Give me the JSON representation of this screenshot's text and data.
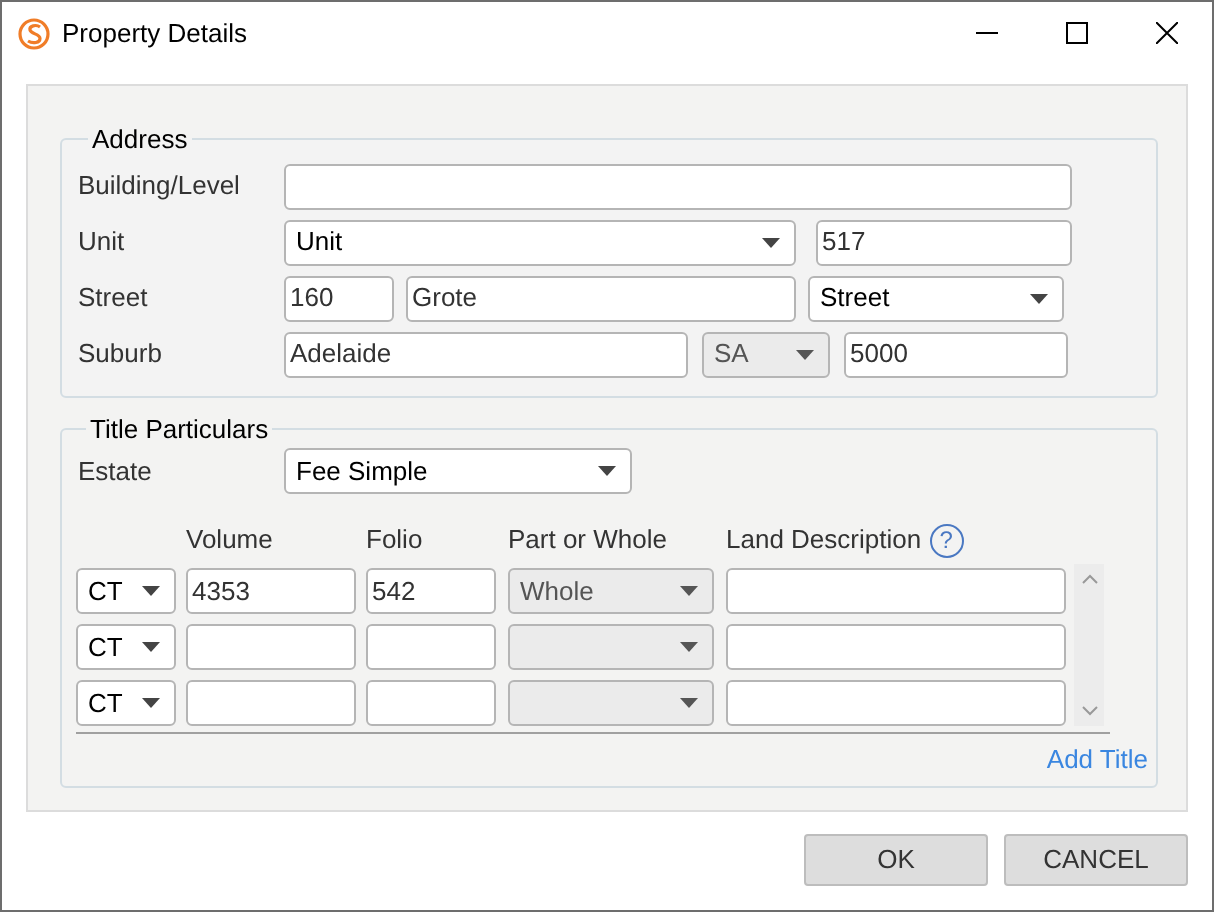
{
  "window": {
    "title": "Property Details"
  },
  "address": {
    "legend": "Address",
    "rows": [
      {
        "label": "Building/Level",
        "fields": [
          {
            "kind": "input"
          }
        ]
      },
      {
        "label": "Unit",
        "fields": [
          {
            "kind": "select",
            "value": "Unit",
            "disabled": false
          },
          {
            "kind": "input",
            "value": "517"
          }
        ]
      },
      {
        "label": "Street",
        "fields": [
          {
            "kind": "input",
            "value": "160"
          },
          {
            "kind": "input",
            "value": "Grote"
          },
          {
            "kind": "select",
            "value": "Street",
            "disabled": false
          }
        ]
      },
      {
        "label": "Suburb",
        "fields": [
          {
            "kind": "input",
            "value": "Adelaide"
          },
          {
            "kind": "select",
            "value": "SA",
            "disabled": true
          },
          {
            "kind": "input",
            "value": "5000"
          }
        ]
      }
    ]
  },
  "title_particulars": {
    "legend": "Title Particulars",
    "estate": {
      "label": "Estate",
      "value": "Fee Simple"
    },
    "columns": [
      "Volume",
      "Folio",
      "Part or Whole",
      "Land Description"
    ],
    "help": "?",
    "rows": [
      {
        "type": "CT",
        "volume": "4353",
        "folio": "542",
        "part": "Whole",
        "part_disabled": true
      },
      {
        "type": "CT",
        "part_disabled": true
      },
      {
        "type": "CT",
        "part_disabled": true
      }
    ],
    "add_link": "Add Title"
  },
  "buttons": [
    "OK",
    "CANCEL"
  ]
}
